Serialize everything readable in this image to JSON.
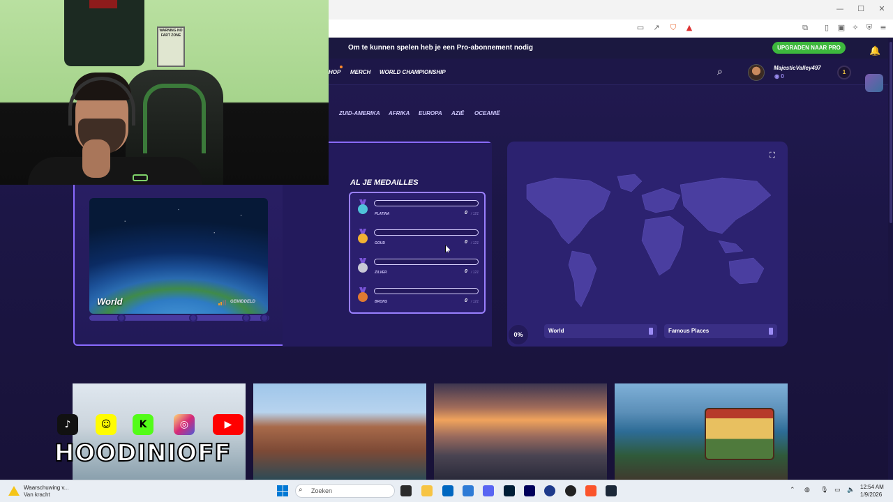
{
  "window": {
    "minimize": "—",
    "maximize": "☐",
    "close": "✕"
  },
  "site": {
    "promo_text": "Om te kunnen spelen heb je een Pro-abonnement nodig",
    "upgrade_label": "UPGRADEN NAAR PRO",
    "nav": [
      "HOP",
      "MERCH",
      "WORLD CHAMPIONSHIP"
    ],
    "user": {
      "name": "MajesticValley497",
      "coins": "0",
      "level": "1"
    },
    "regions": [
      "ZUID-AMERIKA",
      "AFRIKA",
      "EUROPA",
      "AZIË",
      "OCEANIË"
    ],
    "medals": {
      "title": "AL JE MEDAILLES",
      "items": [
        {
          "label": "PLATINA",
          "count": "0",
          "total": "/ 121",
          "color": "#4fc3d9"
        },
        {
          "label": "GOUD",
          "count": "0",
          "total": "/ 121",
          "color": "#f2b233"
        },
        {
          "label": "ZILVER",
          "count": "0",
          "total": "/ 121",
          "color": "#c9c9d6"
        },
        {
          "label": "BRONS",
          "count": "0",
          "total": "/ 121",
          "color": "#e07a32"
        }
      ]
    },
    "world_card": {
      "title": "World",
      "difficulty": "GEMIDDELD"
    },
    "map": {
      "progress": "0%",
      "tags": [
        "World",
        "Famous Places"
      ]
    }
  },
  "overlay": {
    "brand": "HOODINIOFF",
    "sign": "WARNING NO FART ZONE",
    "socials": [
      "tiktok-icon",
      "snapchat-icon",
      "kick-icon",
      "instagram-icon",
      "youtube-icon"
    ],
    "tiktok_caption": "TikTok"
  },
  "taskbar": {
    "warning_title": "Waarschuwing v...",
    "warning_sub": "Van kracht",
    "search_placeholder": "Zoeken",
    "time": "12:54 AM",
    "date": "1/9/2026",
    "badge": "7"
  }
}
